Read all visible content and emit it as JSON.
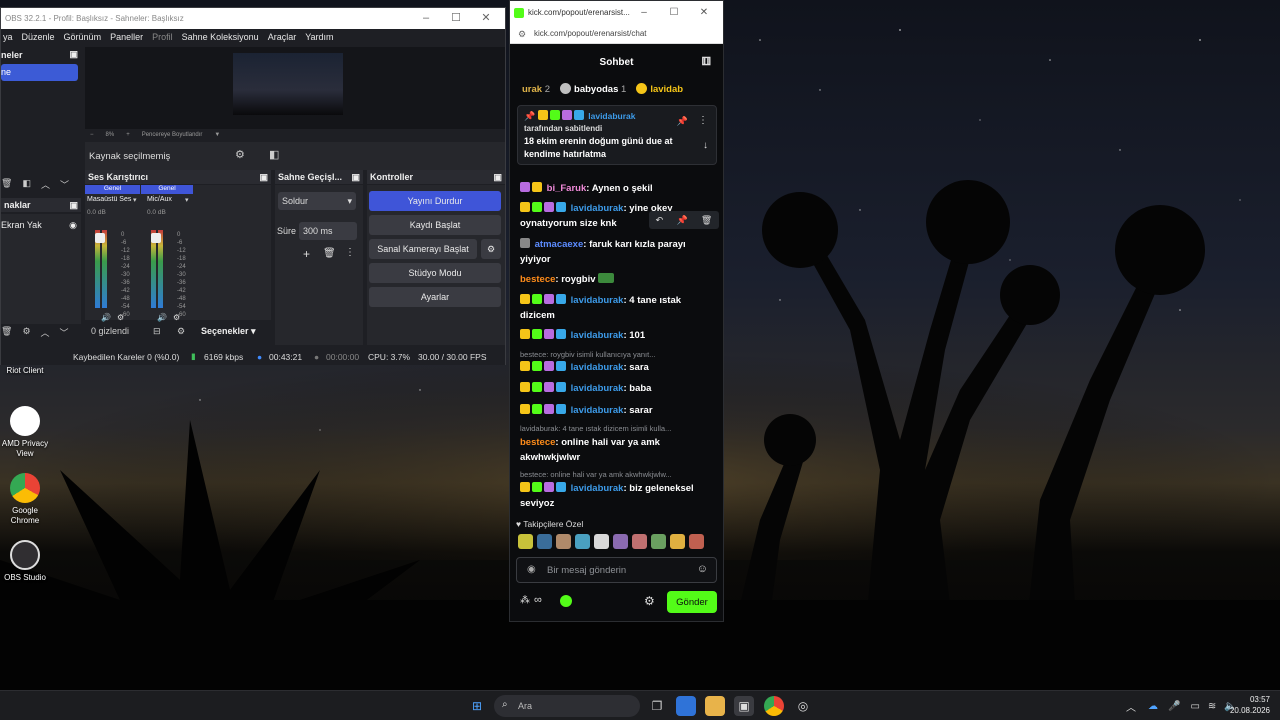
{
  "obs": {
    "title": "OBS 32.2.1 - Profil: Başlıksız - Sahneler: Başlıksız",
    "menu": [
      "ya",
      "Düzenle",
      "Görünüm",
      "Paneller",
      "Profil",
      "Sahne Koleksiyonu",
      "Araçlar",
      "Yardım"
    ],
    "scenes_title": "neler",
    "scene_selected": "ne",
    "sources_title": "naklar",
    "source_item": "Ekran Yak",
    "zoom_minus": "−",
    "zoom_pct": "8%",
    "zoom_plus": "+",
    "zoom_fit": "Pencereye Boyutlandır",
    "no_source": "Kaynak seçilmemiş",
    "mixer_title": "Ses Karıştırıcı",
    "track1_group": "Genel",
    "track2_group": "Genel",
    "track1_name": "Masaüstü Ses",
    "track2_name": "Mic/Aux",
    "track1_db": "0.0 dB",
    "track2_db": "0.0 dB",
    "db_scale": [
      "0",
      "-6",
      "-12",
      "-18",
      "-24",
      "-30",
      "-36",
      "-42",
      "-48",
      "-54",
      "-60"
    ],
    "hidden_count": "0 gizlendi",
    "options": "Seçenekler",
    "transitions_title": "Sahne Geçişl...",
    "transition_value": "Soldur",
    "duration_label": "Süre",
    "duration_value": "300 ms",
    "controls_title": "Kontroller",
    "controls": {
      "stop_stream": "Yayını Durdur",
      "start_record": "Kaydı Başlat",
      "virtual_cam": "Sanal Kamerayı Başlat",
      "studio_mode": "Stüdyo Modu",
      "settings": "Ayarlar"
    },
    "status": {
      "dropped": "Kaybedilen Kareler 0 (%0.0)",
      "kbps": "6169 kbps",
      "stream_time": "00:43:21",
      "rec_time": "00:00:00",
      "cpu": "CPU: 3.7%",
      "fps": "30.00 / 30.00 FPS"
    }
  },
  "desktop": {
    "icons": [
      "Riot Client",
      "AMD Privacy View",
      "Google Chrome",
      "OBS Studio"
    ]
  },
  "chrome": {
    "tab_title": "kick.com/popout/erenarsist...",
    "url": "kick.com/popout/erenarsist/chat"
  },
  "chat": {
    "header": "Sohbet",
    "top_gifters": [
      {
        "name": "urak",
        "rank": "2"
      },
      {
        "name": "babyodas",
        "rank": "1"
      },
      {
        "name": "lavidab",
        "rank": ""
      }
    ],
    "pinned": {
      "user": "lavidaburak",
      "pinned_by": "tarafından sabitlendi",
      "message": "18 ekim erenin doğum günü due at kendime hatırlatma"
    },
    "messages": [
      {
        "user": "bi_Faruk",
        "sep": ":",
        "text": "Aynen o şekil",
        "color": "#f08ad8"
      },
      {
        "user": "lavidaburak",
        "sep": ":",
        "text": "yine okey oynatıyorum size knk",
        "color": "#3d9be9"
      },
      {
        "user": "atmacaexe",
        "sep": ":",
        "text": "faruk karı kızla parayı yiyiyor",
        "color": "#5c8cff"
      },
      {
        "user": "bestece",
        "sep": ":",
        "text": "roygbiv",
        "color": "#ff8c1a"
      },
      {
        "user": "lavidaburak",
        "sep": ":",
        "text": "4 tane ıstak dizicem",
        "color": "#3d9be9"
      },
      {
        "user": "lavidaburak",
        "sep": ":",
        "text": "101",
        "color": "#3d9be9"
      },
      {
        "user": "lavidaburak",
        "sep": ":",
        "text": "sara",
        "color": "#3d9be9"
      },
      {
        "user": "lavidaburak",
        "sep": ":",
        "text": "baba",
        "color": "#3d9be9"
      },
      {
        "user": "lavidaburak",
        "sep": ":",
        "text": "sarar",
        "color": "#3d9be9"
      },
      {
        "user": "bestece",
        "sep": ":",
        "text": "online hali var ya amk akwhwkjwlwr",
        "color": "#ff8c1a"
      },
      {
        "user": "lavidaburak",
        "sep": ":",
        "text": "biz geleneksel seviyoz",
        "color": "#3d9be9"
      }
    ],
    "replies": [
      "bestece: roygbiv isimli kullanıcıya yanıt...",
      "lavidaburak: 4 tane ıstak dizicem isimli kulla...",
      "bestece: online hali var ya amk akwhwkjwlw..."
    ],
    "follow_only": "Takipçilere Özel",
    "input_placeholder": "Bir mesaj gönderin",
    "send": "Gönder",
    "infinity": "∞"
  },
  "taskbar": {
    "search_placeholder": "Ara",
    "time": "03:57",
    "date": "20.08.2026"
  },
  "colors": {
    "kick_green": "#53fc18",
    "obs_blue": "#3f55d8",
    "username_blue": "#3d9be9"
  }
}
